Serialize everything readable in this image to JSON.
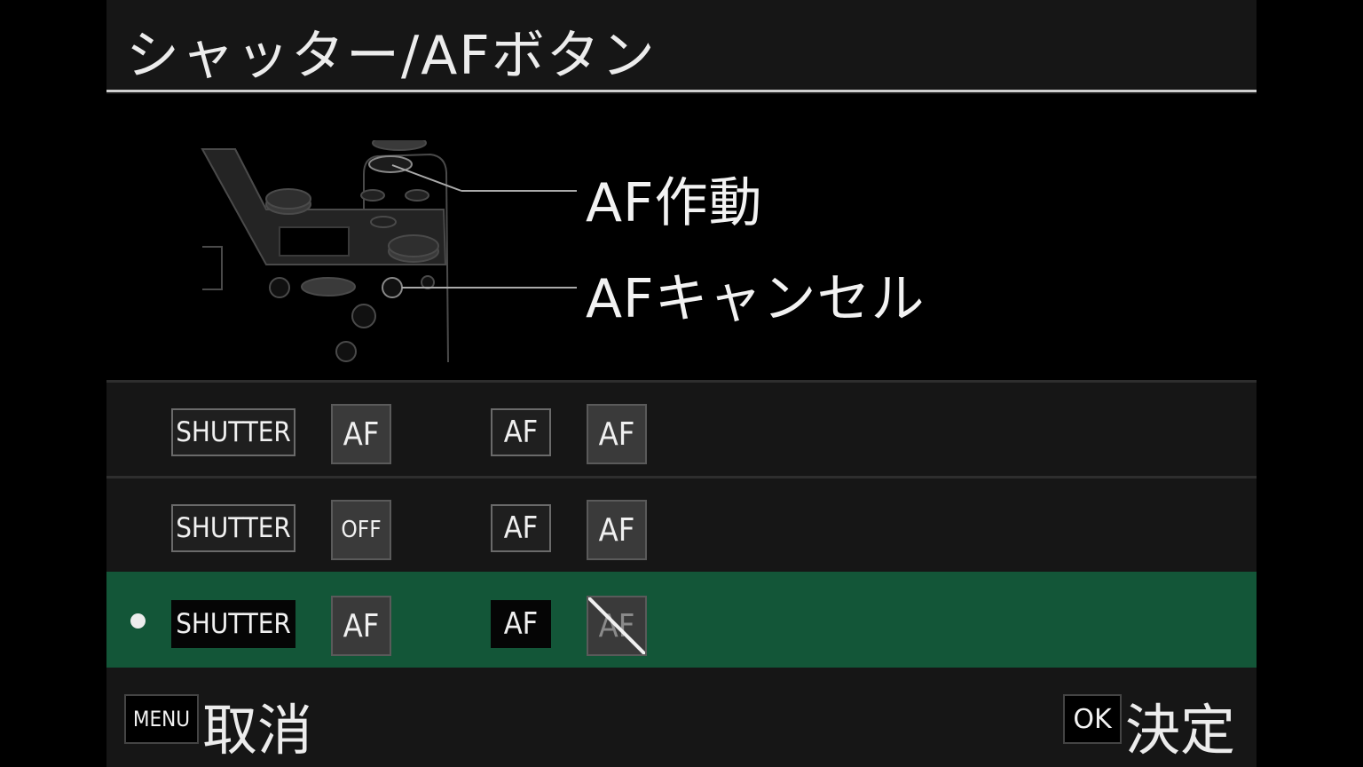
{
  "title": "シャッター/AFボタン",
  "diagram": {
    "callouts": [
      "AF作動",
      "AFキャンセル"
    ],
    "illustration": "camera-top-buttons-diagram"
  },
  "options": [
    {
      "labels": [
        "SHUTTER",
        "AF",
        "AF",
        "AF"
      ],
      "selected": false,
      "third_disabled": false
    },
    {
      "labels": [
        "SHUTTER",
        "OFF",
        "AF",
        "AF"
      ],
      "selected": false,
      "third_disabled": false
    },
    {
      "labels": [
        "SHUTTER",
        "AF",
        "AF",
        "AF"
      ],
      "selected": true,
      "third_disabled": true
    }
  ],
  "footer": {
    "menu_key": "MENU",
    "cancel_label": "取消",
    "ok_key": "OK",
    "confirm_label": "決定"
  },
  "colors": {
    "selected_row": "#135638",
    "background": "#161616"
  }
}
